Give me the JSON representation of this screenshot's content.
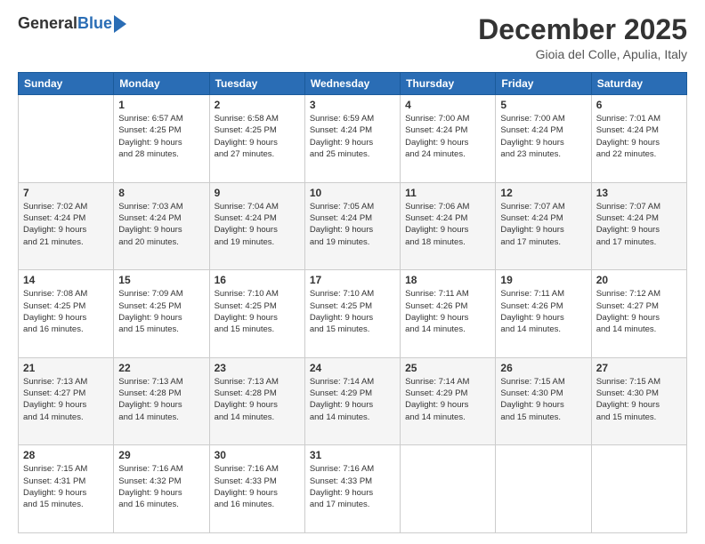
{
  "header": {
    "logo_general": "General",
    "logo_blue": "Blue",
    "month_title": "December 2025",
    "location": "Gioia del Colle, Apulia, Italy"
  },
  "weekdays": [
    "Sunday",
    "Monday",
    "Tuesday",
    "Wednesday",
    "Thursday",
    "Friday",
    "Saturday"
  ],
  "weeks": [
    [
      {
        "day": "",
        "info": ""
      },
      {
        "day": "1",
        "info": "Sunrise: 6:57 AM\nSunset: 4:25 PM\nDaylight: 9 hours\nand 28 minutes."
      },
      {
        "day": "2",
        "info": "Sunrise: 6:58 AM\nSunset: 4:25 PM\nDaylight: 9 hours\nand 27 minutes."
      },
      {
        "day": "3",
        "info": "Sunrise: 6:59 AM\nSunset: 4:24 PM\nDaylight: 9 hours\nand 25 minutes."
      },
      {
        "day": "4",
        "info": "Sunrise: 7:00 AM\nSunset: 4:24 PM\nDaylight: 9 hours\nand 24 minutes."
      },
      {
        "day": "5",
        "info": "Sunrise: 7:00 AM\nSunset: 4:24 PM\nDaylight: 9 hours\nand 23 minutes."
      },
      {
        "day": "6",
        "info": "Sunrise: 7:01 AM\nSunset: 4:24 PM\nDaylight: 9 hours\nand 22 minutes."
      }
    ],
    [
      {
        "day": "7",
        "info": "Sunrise: 7:02 AM\nSunset: 4:24 PM\nDaylight: 9 hours\nand 21 minutes."
      },
      {
        "day": "8",
        "info": "Sunrise: 7:03 AM\nSunset: 4:24 PM\nDaylight: 9 hours\nand 20 minutes."
      },
      {
        "day": "9",
        "info": "Sunrise: 7:04 AM\nSunset: 4:24 PM\nDaylight: 9 hours\nand 19 minutes."
      },
      {
        "day": "10",
        "info": "Sunrise: 7:05 AM\nSunset: 4:24 PM\nDaylight: 9 hours\nand 19 minutes."
      },
      {
        "day": "11",
        "info": "Sunrise: 7:06 AM\nSunset: 4:24 PM\nDaylight: 9 hours\nand 18 minutes."
      },
      {
        "day": "12",
        "info": "Sunrise: 7:07 AM\nSunset: 4:24 PM\nDaylight: 9 hours\nand 17 minutes."
      },
      {
        "day": "13",
        "info": "Sunrise: 7:07 AM\nSunset: 4:24 PM\nDaylight: 9 hours\nand 17 minutes."
      }
    ],
    [
      {
        "day": "14",
        "info": "Sunrise: 7:08 AM\nSunset: 4:25 PM\nDaylight: 9 hours\nand 16 minutes."
      },
      {
        "day": "15",
        "info": "Sunrise: 7:09 AM\nSunset: 4:25 PM\nDaylight: 9 hours\nand 15 minutes."
      },
      {
        "day": "16",
        "info": "Sunrise: 7:10 AM\nSunset: 4:25 PM\nDaylight: 9 hours\nand 15 minutes."
      },
      {
        "day": "17",
        "info": "Sunrise: 7:10 AM\nSunset: 4:25 PM\nDaylight: 9 hours\nand 15 minutes."
      },
      {
        "day": "18",
        "info": "Sunrise: 7:11 AM\nSunset: 4:26 PM\nDaylight: 9 hours\nand 14 minutes."
      },
      {
        "day": "19",
        "info": "Sunrise: 7:11 AM\nSunset: 4:26 PM\nDaylight: 9 hours\nand 14 minutes."
      },
      {
        "day": "20",
        "info": "Sunrise: 7:12 AM\nSunset: 4:27 PM\nDaylight: 9 hours\nand 14 minutes."
      }
    ],
    [
      {
        "day": "21",
        "info": "Sunrise: 7:13 AM\nSunset: 4:27 PM\nDaylight: 9 hours\nand 14 minutes."
      },
      {
        "day": "22",
        "info": "Sunrise: 7:13 AM\nSunset: 4:28 PM\nDaylight: 9 hours\nand 14 minutes."
      },
      {
        "day": "23",
        "info": "Sunrise: 7:13 AM\nSunset: 4:28 PM\nDaylight: 9 hours\nand 14 minutes."
      },
      {
        "day": "24",
        "info": "Sunrise: 7:14 AM\nSunset: 4:29 PM\nDaylight: 9 hours\nand 14 minutes."
      },
      {
        "day": "25",
        "info": "Sunrise: 7:14 AM\nSunset: 4:29 PM\nDaylight: 9 hours\nand 14 minutes."
      },
      {
        "day": "26",
        "info": "Sunrise: 7:15 AM\nSunset: 4:30 PM\nDaylight: 9 hours\nand 15 minutes."
      },
      {
        "day": "27",
        "info": "Sunrise: 7:15 AM\nSunset: 4:30 PM\nDaylight: 9 hours\nand 15 minutes."
      }
    ],
    [
      {
        "day": "28",
        "info": "Sunrise: 7:15 AM\nSunset: 4:31 PM\nDaylight: 9 hours\nand 15 minutes."
      },
      {
        "day": "29",
        "info": "Sunrise: 7:16 AM\nSunset: 4:32 PM\nDaylight: 9 hours\nand 16 minutes."
      },
      {
        "day": "30",
        "info": "Sunrise: 7:16 AM\nSunset: 4:33 PM\nDaylight: 9 hours\nand 16 minutes."
      },
      {
        "day": "31",
        "info": "Sunrise: 7:16 AM\nSunset: 4:33 PM\nDaylight: 9 hours\nand 17 minutes."
      },
      {
        "day": "",
        "info": ""
      },
      {
        "day": "",
        "info": ""
      },
      {
        "day": "",
        "info": ""
      }
    ]
  ]
}
